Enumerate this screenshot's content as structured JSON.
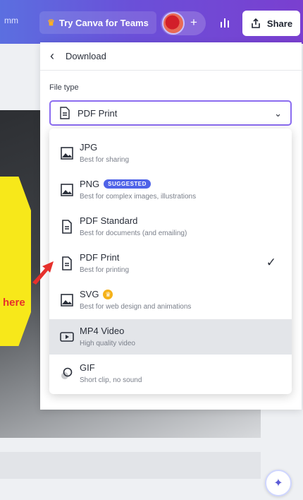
{
  "topbar": {
    "left_text": "mm",
    "try_label": "Try Canva for Teams",
    "share_label": "Share"
  },
  "panel": {
    "title": "Download",
    "file_type_label": "File type",
    "selected": "PDF Print"
  },
  "canvas": {
    "here_text": "here"
  },
  "options": [
    {
      "title": "JPG",
      "subtitle": "Best for sharing",
      "icon": "image-icon"
    },
    {
      "title": "PNG",
      "badge": "SUGGESTED",
      "subtitle": "Best for complex images, illustrations",
      "icon": "image-icon"
    },
    {
      "title": "PDF Standard",
      "subtitle": "Best for documents (and emailing)",
      "icon": "document-icon"
    },
    {
      "title": "PDF Print",
      "subtitle": "Best for printing",
      "icon": "document-icon",
      "checked": true
    },
    {
      "title": "SVG",
      "subtitle": "Best for web design and animations",
      "icon": "image-icon",
      "pro": true
    },
    {
      "title": "MP4 Video",
      "subtitle": "High quality video",
      "icon": "video-icon",
      "highlighted": true
    },
    {
      "title": "GIF",
      "subtitle": "Short clip, no sound",
      "icon": "gif-icon"
    }
  ],
  "colors": {
    "accent": "#8b6cf0",
    "badge": "#4f63e8",
    "pro": "#f5b21a",
    "arrow": "#e6302c"
  }
}
